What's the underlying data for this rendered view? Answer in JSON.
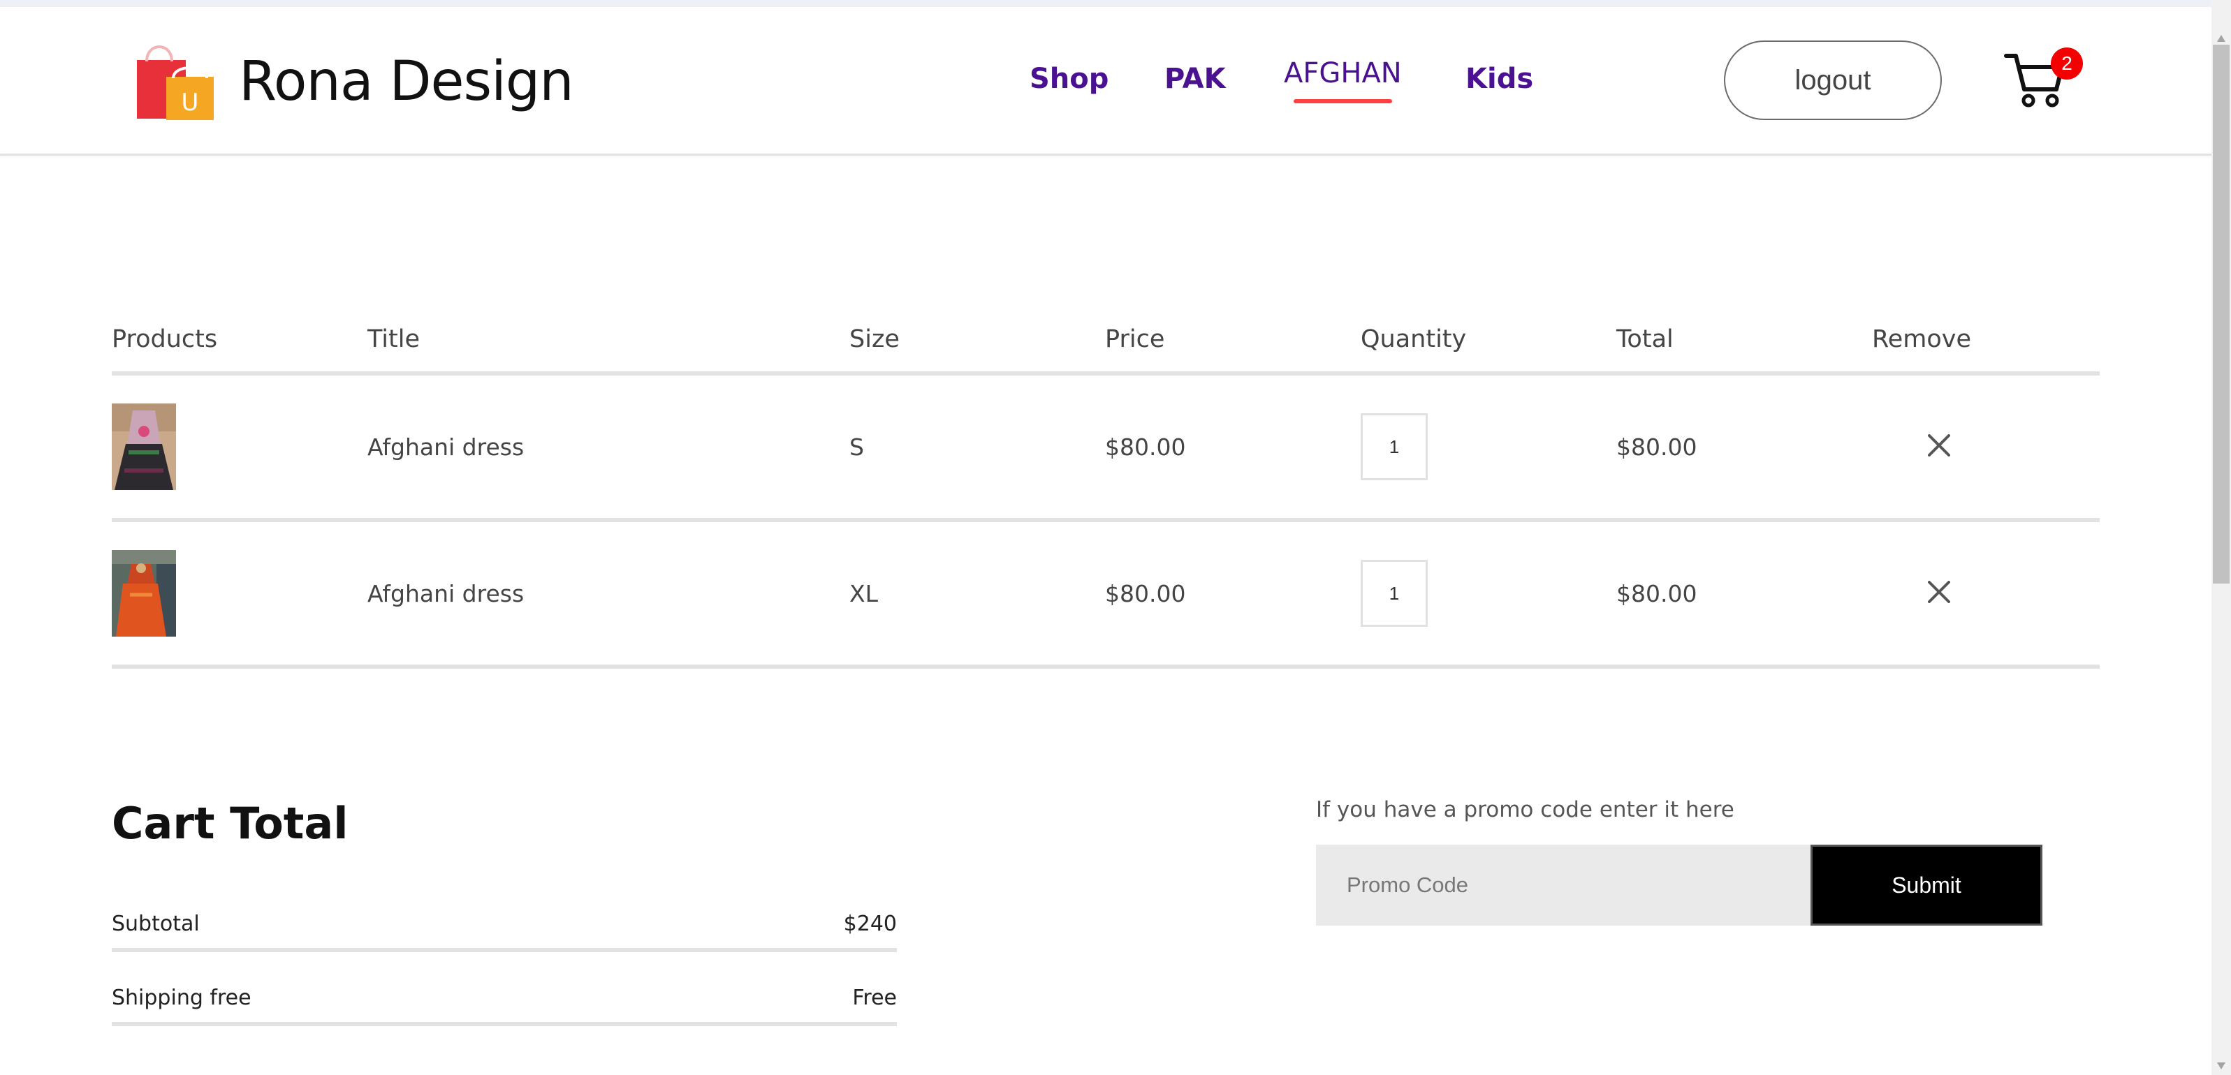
{
  "header": {
    "brand_name": "Rona Design",
    "nav": [
      {
        "label": "Shop"
      },
      {
        "label": "PAK"
      },
      {
        "label": "AFGHAN"
      },
      {
        "label": "Kids"
      }
    ],
    "logout_label": "logout",
    "cart_count": "2"
  },
  "cart": {
    "columns": [
      "Products",
      "Title",
      "Size",
      "Price",
      "Quantity",
      "Total",
      "Remove"
    ],
    "items": [
      {
        "title": "Afghani dress",
        "size": "S",
        "price": "$80.00",
        "quantity": "1",
        "total": "$80.00"
      },
      {
        "title": "Afghani dress",
        "size": "XL",
        "price": "$80.00",
        "quantity": "1",
        "total": "$80.00"
      }
    ]
  },
  "totals": {
    "heading": "Cart Total",
    "subtotal_label": "Subtotal",
    "subtotal_value": "$240",
    "shipping_label": "Shipping free",
    "shipping_value": "Free"
  },
  "promo": {
    "prompt": "If you have a promo code enter it here",
    "placeholder": "Promo Code",
    "submit_label": "Submit"
  },
  "colors": {
    "nav_text": "#4a1290",
    "active_underline": "#ff4141",
    "badge": "#f40000",
    "divider": "#e2e2e2"
  }
}
